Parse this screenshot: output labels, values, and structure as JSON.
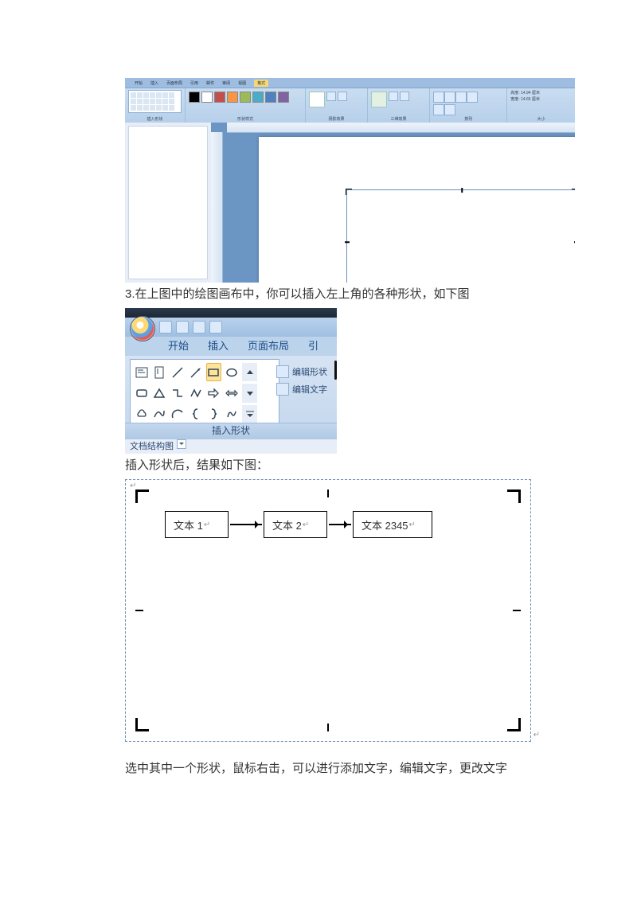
{
  "shot1": {
    "ribbon_tabs": [
      "开始",
      "插入",
      "页面布局",
      "引用",
      "邮件",
      "审阅",
      "视图",
      "格式"
    ],
    "active_tab": "格式",
    "groups": {
      "insert_shape": "插入形状",
      "shape_style": "形状样式",
      "shadow": "阴影效果",
      "threeD": "三维效果",
      "arrange": "排列",
      "size": "大小"
    },
    "colors": [
      "#000000",
      "#ffffff",
      "#c1504d",
      "#f79646",
      "#9bbb59",
      "#4bacc6",
      "#4f81bd",
      "#8064a2"
    ],
    "size_fields": {
      "h_label": "高度:",
      "h_val": "14.94 厘米",
      "w_label": "宽度:",
      "w_val": "14.65 厘米"
    }
  },
  "text_step3": "3.在上图中的绘图画布中，你可以插入左上角的各种形状，如下图",
  "shot2": {
    "tabs": [
      "开始",
      "插入",
      "页面布局",
      "引"
    ],
    "edit_shape": "编辑形状",
    "edit_text": "编辑文字",
    "group_label": "插入形状",
    "doc_struct": "文档结构图"
  },
  "text_after_shot2": "插入形状后，结果如下图：",
  "canvas": {
    "box1": "文本 1",
    "box2": "文本 2",
    "box3": "文本 2345"
  },
  "text_last": "选中其中一个形状，鼠标右击，可以进行添加文字，编辑文字，更改文字"
}
